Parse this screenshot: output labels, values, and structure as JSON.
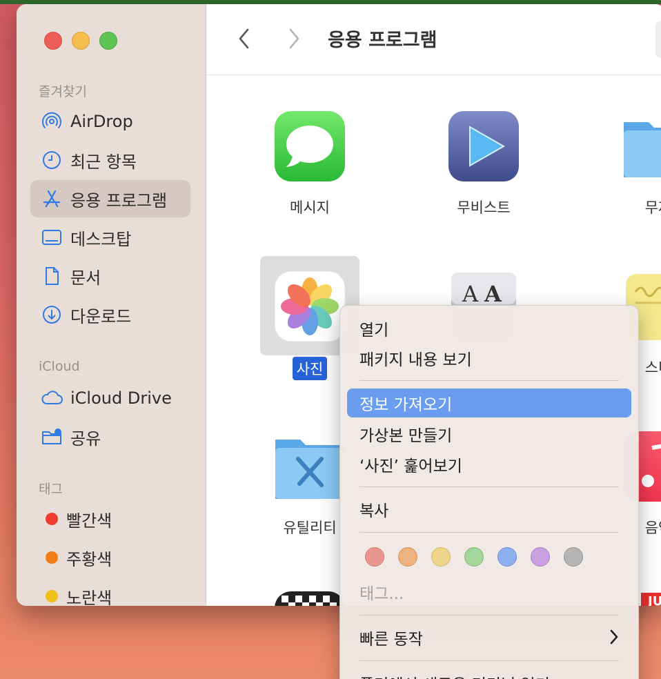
{
  "window": {
    "title": "응용 프로그램"
  },
  "sidebar": {
    "sections": {
      "favorites": "즐겨찾기",
      "icloud": "iCloud",
      "tags": "태그"
    },
    "favorites": [
      {
        "label": "AirDrop",
        "icon": "airdrop-icon"
      },
      {
        "label": "최근 항목",
        "icon": "clock-icon"
      },
      {
        "label": "응용 프로그램",
        "icon": "applications-icon",
        "selected": true
      },
      {
        "label": "데스크탑",
        "icon": "desktop-icon"
      },
      {
        "label": "문서",
        "icon": "document-icon"
      },
      {
        "label": "다운로드",
        "icon": "download-icon"
      }
    ],
    "icloud": [
      {
        "label": "iCloud Drive",
        "icon": "cloud-icon"
      },
      {
        "label": "공유",
        "icon": "shared-folder-icon"
      }
    ],
    "tags": [
      {
        "label": "빨간색",
        "color": "#f23b30"
      },
      {
        "label": "주황색",
        "color": "#ef7d14"
      },
      {
        "label": "노란색",
        "color": "#f0c116"
      }
    ]
  },
  "apps": [
    {
      "label": "메시지",
      "icon": "messages-icon"
    },
    {
      "label": "무비스트",
      "icon": "movist-icon"
    },
    {
      "label": "무제",
      "icon": "folder-icon"
    },
    {
      "label": "사진",
      "icon": "photos-icon",
      "selected": true
    },
    {
      "label": "",
      "icon": "font-book-icon"
    },
    {
      "label": "스티",
      "icon": "stickies-icon"
    },
    {
      "label": "유틸리티",
      "icon": "utilities-folder-icon"
    },
    {
      "label": "음악",
      "icon": "music-icon"
    },
    {
      "label": "",
      "icon": "chess-icon"
    },
    {
      "label": "JU",
      "icon": "app-icon"
    }
  ],
  "context_menu": {
    "items": [
      {
        "label": "열기"
      },
      {
        "label": "패키지 내용 보기"
      },
      {
        "label": "정보 가져오기",
        "highlighted": true
      },
      {
        "label": "가상본 만들기"
      },
      {
        "label": "‘사진’ 훑어보기"
      },
      {
        "label": "복사"
      },
      {
        "label": "태그...",
        "disabled": true
      },
      {
        "label": "빠른 동작"
      },
      {
        "label": "폴더에서 새로운 터미널 열기"
      }
    ],
    "tag_colors": [
      "#e8968f",
      "#edb27f",
      "#efd48c",
      "#a2d69a",
      "#8fb0ef",
      "#c9a0e2",
      "#b5b5b5"
    ]
  }
}
